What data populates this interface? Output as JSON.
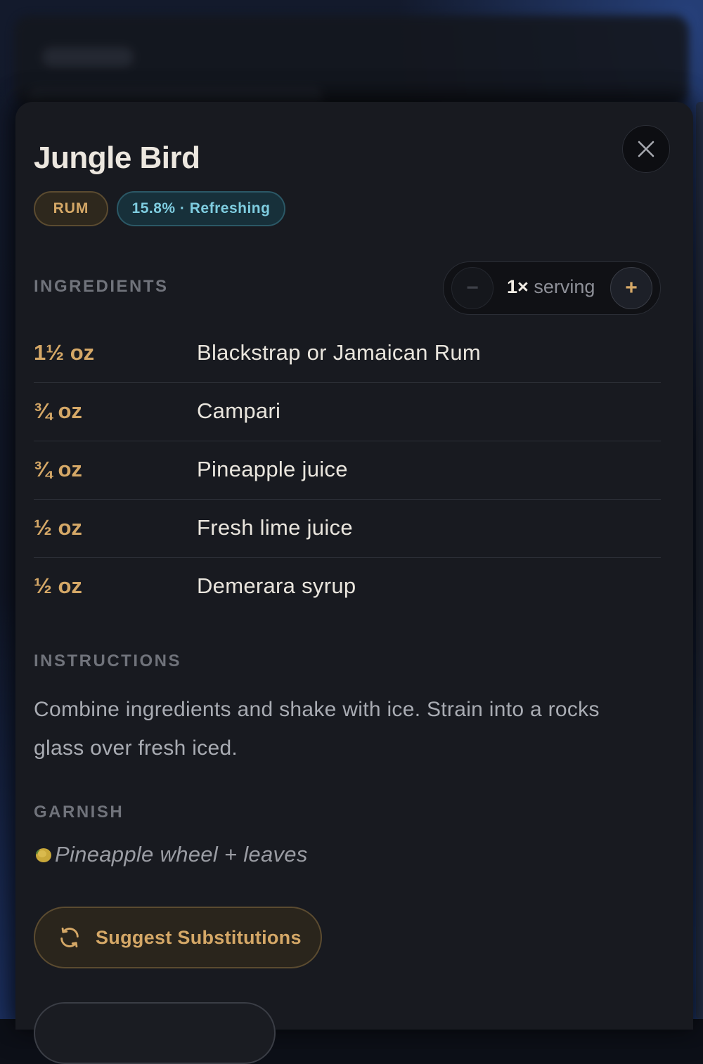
{
  "recipe": {
    "title": "Jungle Bird",
    "spirit_badge": "RUM",
    "abv_badge": "15.8% · Refreshing"
  },
  "ingredients_section": {
    "label": "INGREDIENTS",
    "serving": {
      "multiplier": "1×",
      "unit_label": "serving",
      "decrement_label": "−",
      "increment_label": "+"
    },
    "items": [
      {
        "amount": "1½ oz",
        "name": "Blackstrap or Jamaican Rum"
      },
      {
        "amount": "¾ oz",
        "name": "Campari"
      },
      {
        "amount": "¾ oz",
        "name": "Pineapple juice"
      },
      {
        "amount": "½ oz",
        "name": "Fresh lime juice"
      },
      {
        "amount": "½ oz",
        "name": "Demerara syrup"
      }
    ]
  },
  "instructions_section": {
    "label": "INSTRUCTIONS",
    "text": "Combine ingredients and shake with ice. Strain into a rocks glass over fresh iced."
  },
  "garnish_section": {
    "label": "GARNISH",
    "text": "Pineapple wheel + leaves",
    "icon": "lemon-icon"
  },
  "actions": {
    "suggest_substitutions": "Suggest Substitutions",
    "suggest_icon": "refresh-icon"
  },
  "colors": {
    "accent_gold": "#d5a867",
    "accent_teal": "#7fcde0",
    "sheet_bg": "#181a20"
  }
}
